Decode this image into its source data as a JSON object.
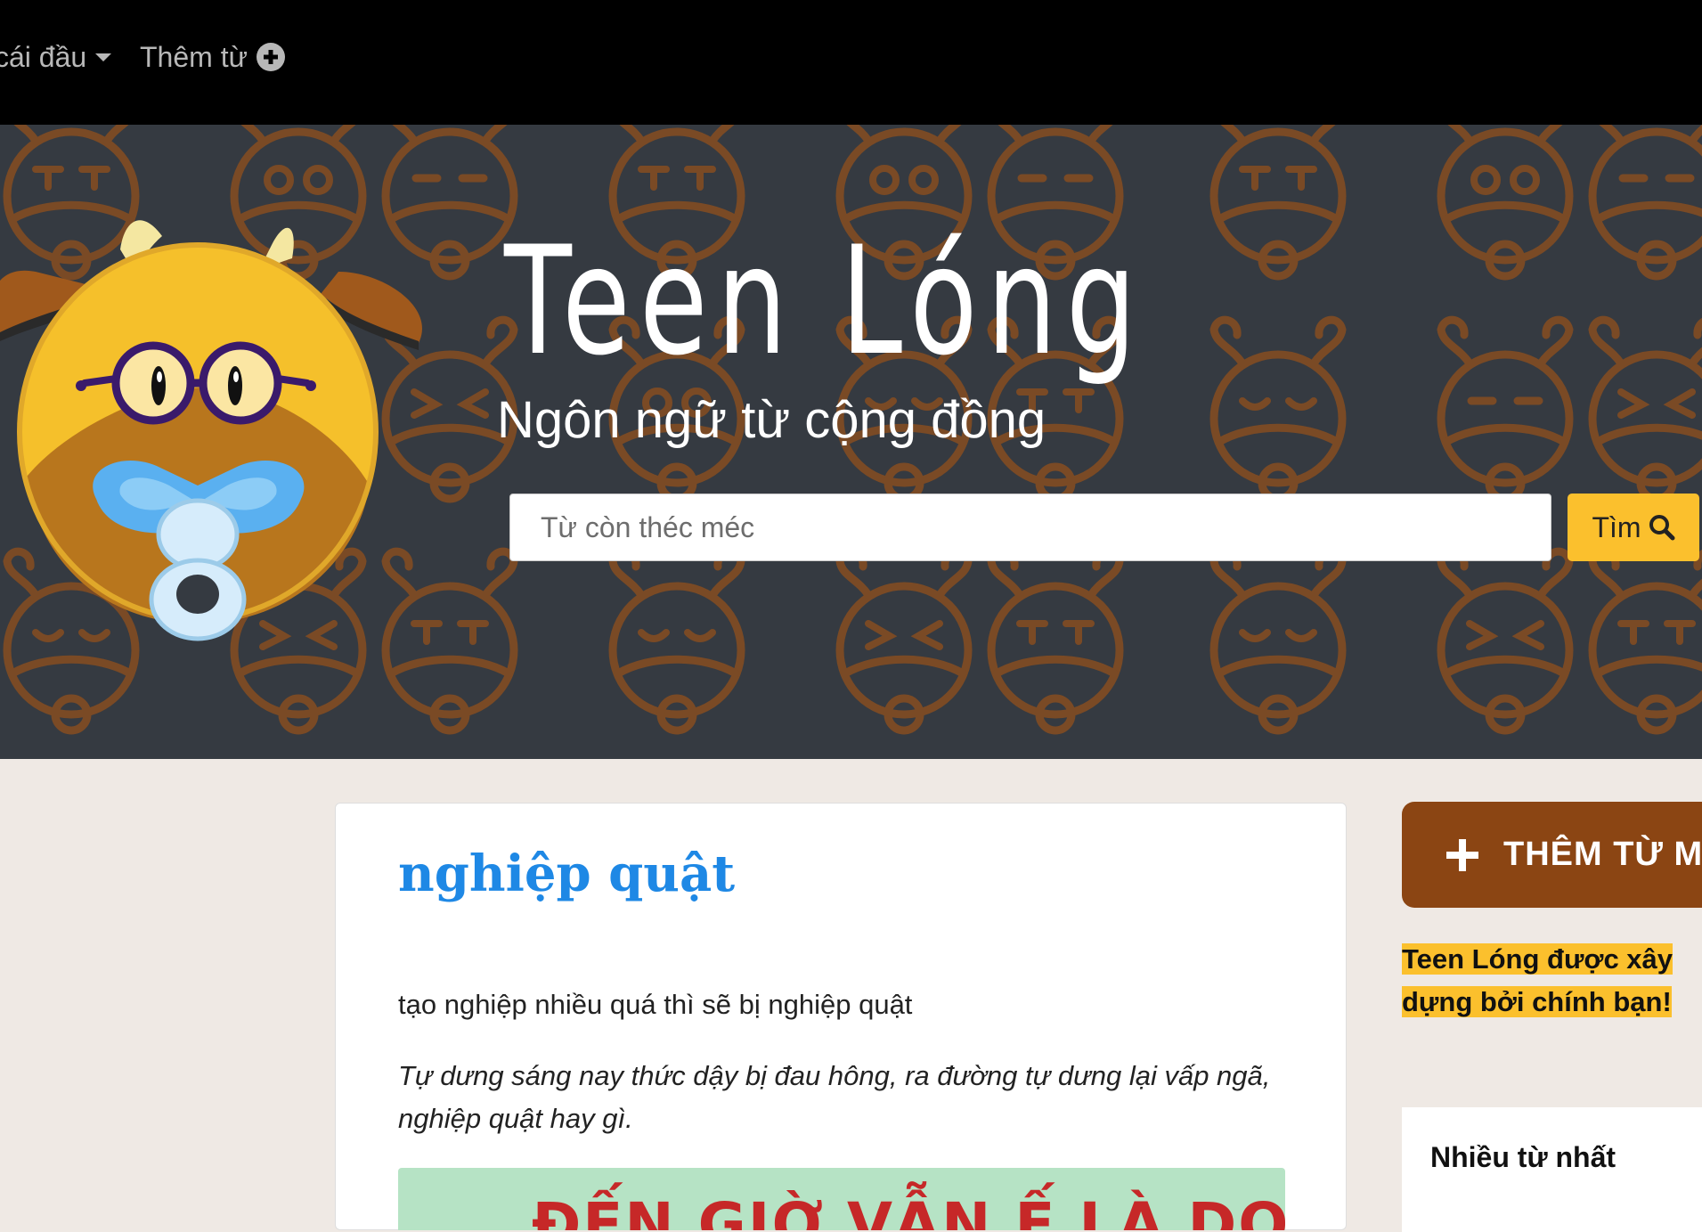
{
  "nav": {
    "items": [
      {
        "label": "cái đầu",
        "icon": "caret-down-icon"
      },
      {
        "label": "Thêm từ",
        "icon": "plus-circle-icon"
      }
    ]
  },
  "hero": {
    "logo": "Teen Lóng",
    "tagline": "Ngôn ngữ từ cộng đồng",
    "search": {
      "placeholder": "Từ còn théc méc",
      "button_label": "Tìm",
      "button_icon": "search-icon"
    },
    "colors": {
      "background": "#353a41",
      "pattern": "#7a4a25",
      "accent": "#fbc02d"
    }
  },
  "entry": {
    "word": "nghiệp quật",
    "definition": "tạo nghiệp nhiều quá thì sẽ bị nghiệp quật",
    "example": "Tự dưng sáng nay thức dậy bị đau hông, ra đường tự dưng lại vấp ngã, nghiệp quật hay gì.",
    "image_caption": "ĐẾN GIỜ VẪN Ế LÀ DO",
    "colors": {
      "title": "#1e88e5"
    }
  },
  "sidebar": {
    "add_button_label": "THÊM TỪ MỚI",
    "add_button_icon": "plus-icon",
    "promo_text": "Teen Lóng được xây dựng bởi chính bạn!",
    "top_words_title": "Nhiều từ nhất",
    "colors": {
      "add_button": "#8b4513",
      "highlight": "#fbc02d"
    }
  }
}
